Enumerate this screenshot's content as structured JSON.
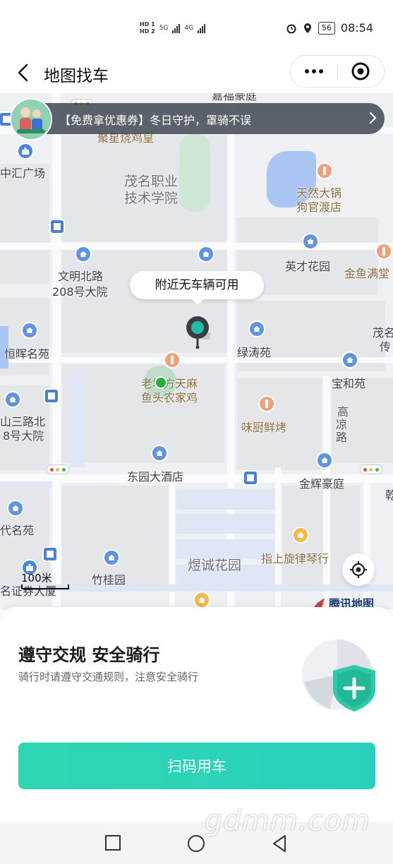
{
  "status_bar": {
    "sim1": "HD 1",
    "sim2": "HD 2",
    "net1": "5G",
    "net2": "4G",
    "battery": "56",
    "time": "08:54"
  },
  "header": {
    "title": "地图找车",
    "icons": [
      "back-arrow-icon",
      "more-dots-icon",
      "close-target-icon"
    ]
  },
  "banner": {
    "text": "【免费拿优惠券】冬日守护，罩骑不误"
  },
  "map": {
    "callout": "附近无车辆可用",
    "labels": [
      "嘉福豪庭",
      "聚星烧鸡皇",
      "中汇广场",
      "茂名职业",
      "技术学院",
      "天然大锅",
      "狗官渡店",
      "文明北路",
      "208号大院",
      "英才花园",
      "金鱼满堂",
      "恒晖名苑",
      "绿涛苑",
      "茂名",
      "传",
      "老地方天麻",
      "鱼头农家鸡",
      "宝和苑",
      "山三路北",
      "8号大院",
      "味厨鲜烤",
      "高",
      "凉",
      "路",
      "东园大酒店",
      "金辉豪庭",
      "乾",
      "代名苑",
      "煜诚花园",
      "指上旋律琴行",
      "竹桂园",
      "名证券大厦"
    ],
    "scale": "100米",
    "provider": "腾讯地图"
  },
  "sheet": {
    "title": "遵守交规 安全骑行",
    "subtitle": "骑行时请遵守交通规则，注意安全骑行",
    "button": "扫码用车"
  },
  "watermark": "gdmm.com",
  "colors": {
    "accent": "#2fd6b2",
    "pin": "#22bfa5",
    "banner_bg": "#464c58"
  }
}
